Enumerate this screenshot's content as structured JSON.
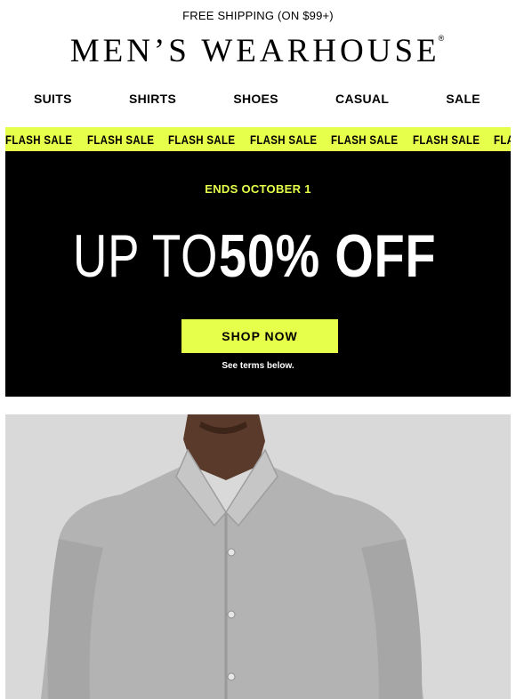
{
  "topbar": {
    "text": "FREE SHIPPING (ON $99+)"
  },
  "brand": {
    "name": "MEN’S WEARHOUSE",
    "reg": "®"
  },
  "nav": {
    "items": [
      "SUITS",
      "SHIRTS",
      "SHOES",
      "CASUAL",
      "SALE"
    ]
  },
  "ticker": {
    "items": [
      "FLASH SALE",
      "FLASH SALE",
      "FLASH SALE",
      "FLASH SALE",
      "FLASH SALE",
      "FLASH SALE",
      "FLASH SALE"
    ],
    "color": "#e6ff4a"
  },
  "hero": {
    "ends": "ENDS OCTOBER 1",
    "headline_light": "UP TO ",
    "headline_bold": "50% OFF",
    "cta": "SHOP NOW",
    "terms": "See terms below.",
    "background": "#000000",
    "accent": "#e6ff4a"
  },
  "product_image": {
    "subject": "man wearing gray dress shirt"
  }
}
